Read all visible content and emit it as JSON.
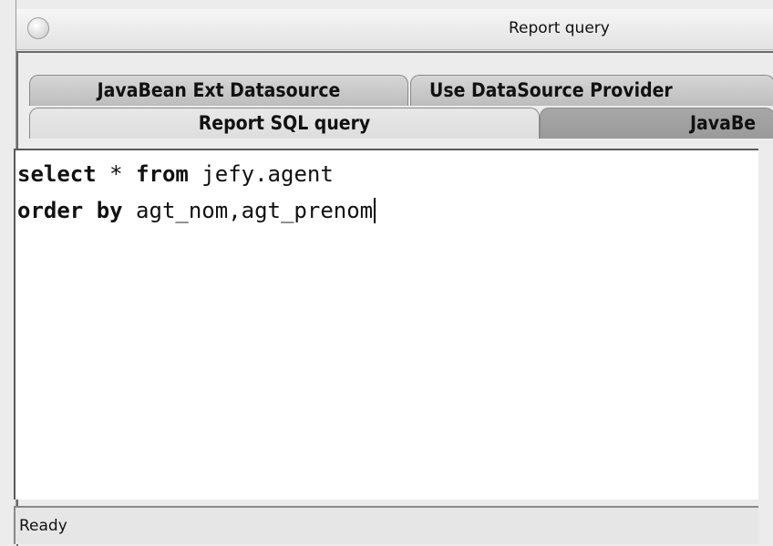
{
  "window": {
    "title": "Report query"
  },
  "tabs": {
    "row1": [
      {
        "label": "JavaBean Ext Datasource"
      },
      {
        "label": "Use DataSource Provider"
      }
    ],
    "row2": [
      {
        "label": "Report SQL query",
        "selected": true
      },
      {
        "label": "JavaBe"
      }
    ]
  },
  "editor": {
    "line1": {
      "kw1": "select",
      "sym": " * ",
      "kw2": "from",
      "rest": " jefy.agent"
    },
    "line2": {
      "kw1": "order by",
      "rest": " agt_nom,agt_prenom"
    }
  },
  "status": {
    "text": "Ready"
  }
}
